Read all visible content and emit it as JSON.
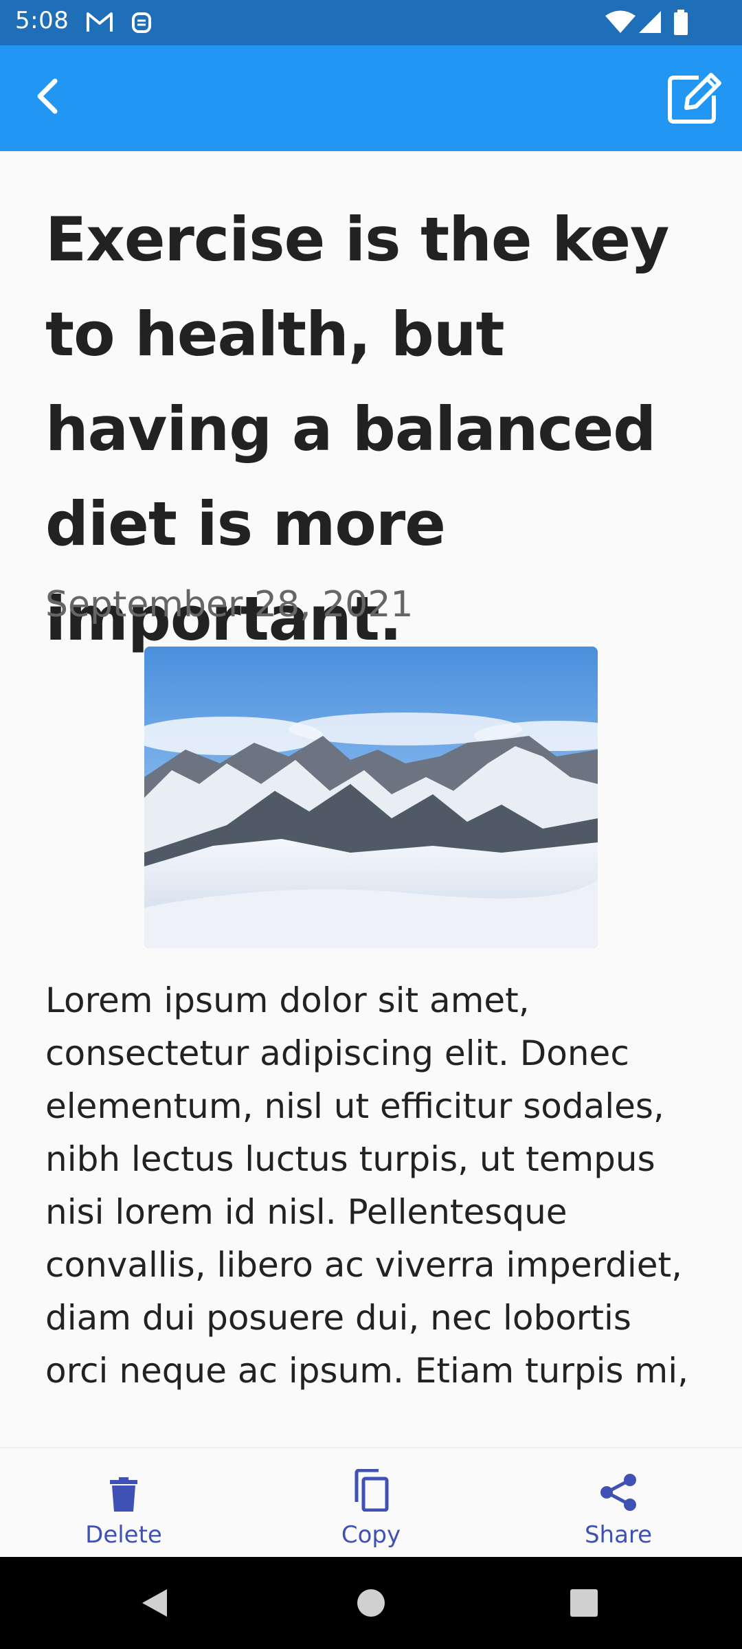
{
  "status_bar": {
    "time": "5:08",
    "icons": [
      "gmail-icon",
      "notification-icon",
      "wifi-icon",
      "signal-icon",
      "battery-icon"
    ]
  },
  "app_bar": {
    "back_icon": "chevron-left-icon",
    "edit_icon": "edit-icon",
    "color": "#2196f3"
  },
  "article": {
    "title": "Exercise is the key to health, but having a balanced diet is more important.",
    "date": "September 28, 2021",
    "image": "snowy-mountains-photo",
    "body": "Lorem ipsum dolor sit amet, consectetur adipiscing elit. Donec elementum, nisl ut efficitur sodales, nibh lectus luctus turpis, ut tempus nisi lorem id nisl. Pellentesque convallis, libero ac viverra imperdiet, diam dui posuere dui, nec lobortis orci neque ac ipsum. Etiam turpis mi,"
  },
  "bottom_actions": [
    {
      "label": "Delete",
      "icon": "trash-icon"
    },
    {
      "label": "Copy",
      "icon": "copy-icon"
    },
    {
      "label": "Share",
      "icon": "share-icon"
    }
  ],
  "accent_color": "#3f51b5",
  "nav_bar": {
    "icons": [
      "back-triangle-icon",
      "home-circle-icon",
      "recents-square-icon"
    ]
  }
}
